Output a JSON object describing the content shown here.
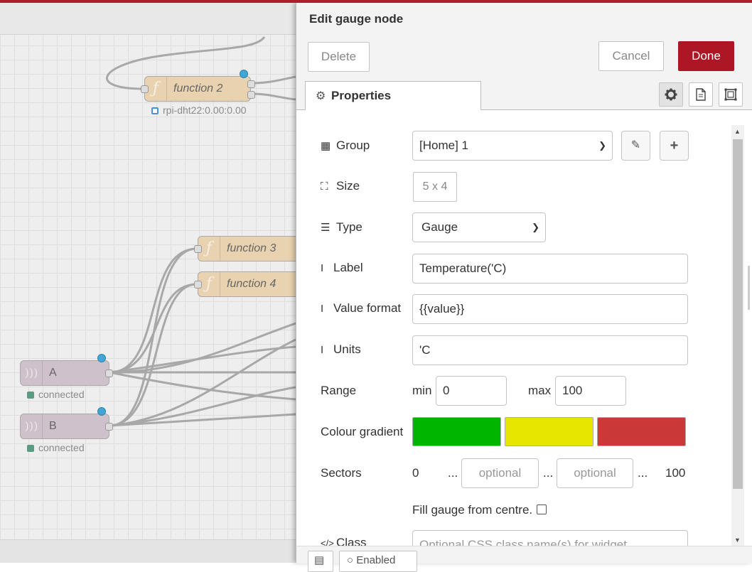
{
  "workspace": {
    "nodes": [
      {
        "id": "function-2",
        "label": "function 2",
        "icon": "function-icon",
        "status": "rpi-dht22:0.00:0.00"
      },
      {
        "id": "function-3",
        "label": "function 3",
        "icon": "function-icon"
      },
      {
        "id": "function-4",
        "label": "function 4",
        "icon": "function-icon"
      },
      {
        "id": "mqtt-a",
        "label": "A",
        "icon": "broadcast-icon",
        "status": "connected"
      },
      {
        "id": "mqtt-b",
        "label": "B",
        "icon": "broadcast-icon",
        "status": "connected"
      }
    ]
  },
  "tray": {
    "title": "Edit gauge node",
    "buttons": {
      "delete": "Delete",
      "cancel": "Cancel",
      "done": "Done"
    },
    "tab": "Properties",
    "form": {
      "group": {
        "label": "Group",
        "value": "[Home] 1"
      },
      "size": {
        "label": "Size",
        "value": "5 x 4"
      },
      "type": {
        "label": "Type",
        "value": "Gauge"
      },
      "label": {
        "label": "Label",
        "value": "Temperature('C)"
      },
      "value_format": {
        "label": "Value format",
        "value": "{{value}}"
      },
      "units": {
        "label": "Units",
        "value": "'C"
      },
      "range": {
        "label": "Range",
        "min_label": "min",
        "min": "0",
        "max_label": "max",
        "max": "100"
      },
      "colour_gradient": {
        "label": "Colour gradient",
        "colors": [
          "#00b500",
          "#e6e600",
          "#ca3838"
        ]
      },
      "sectors": {
        "label": "Sectors",
        "start": "0",
        "dots": "...",
        "placeholder1": "optional",
        "placeholder2": "optional",
        "end": "100"
      },
      "fill_centre": {
        "label": "Fill gauge from centre."
      },
      "class": {
        "label": "Class",
        "placeholder": "Optional CSS class name(s) for widget"
      }
    },
    "footer": {
      "enabled": "Enabled"
    }
  }
}
